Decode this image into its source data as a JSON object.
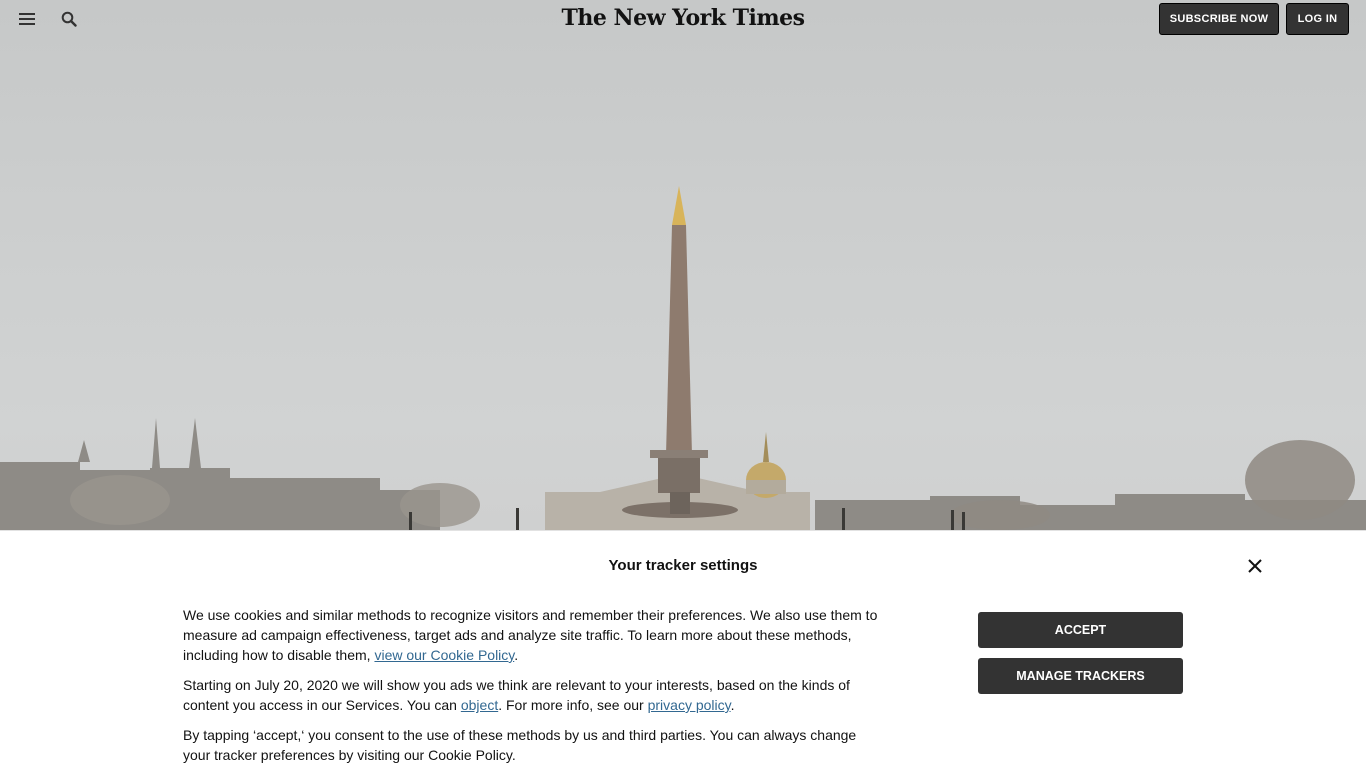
{
  "header": {
    "logo": "The New York Times",
    "subscribe_label": "SUBSCRIBE NOW",
    "login_label": "LOG IN",
    "menu_icon": "hamburger-menu-icon",
    "search_icon": "search-icon"
  },
  "hero": {
    "image_description": "Obelisk at Place de la Concorde, Paris"
  },
  "tracker_banner": {
    "title": "Your tracker settings",
    "close_icon": "close-icon",
    "p1_text": "We use cookies and similar methods to recognize visitors and remember their preferences. We also use them to measure ad campaign effectiveness, target ads and analyze site traffic. To learn more about these methods, including how to disable them, ",
    "p1_link": "view our Cookie Policy",
    "p1_end": ".",
    "p2_text": "Starting on July 20, 2020 we will show you ads we think are relevant to your interests, based on the kinds of content you access in our Services. You can ",
    "p2_link1": "object",
    "p2_mid": ". For more info, see our ",
    "p2_link2": "privacy policy",
    "p2_end": ".",
    "p3_text": "By tapping ‘accept,‘ you consent to the use of these methods by us and third parties. You can always change your tracker preferences by visiting our Cookie Policy.",
    "accept_label": "ACCEPT",
    "manage_label": "MANAGE TRACKERS"
  },
  "colors": {
    "button_bg": "#333333",
    "link": "#326891",
    "text": "#121212"
  }
}
